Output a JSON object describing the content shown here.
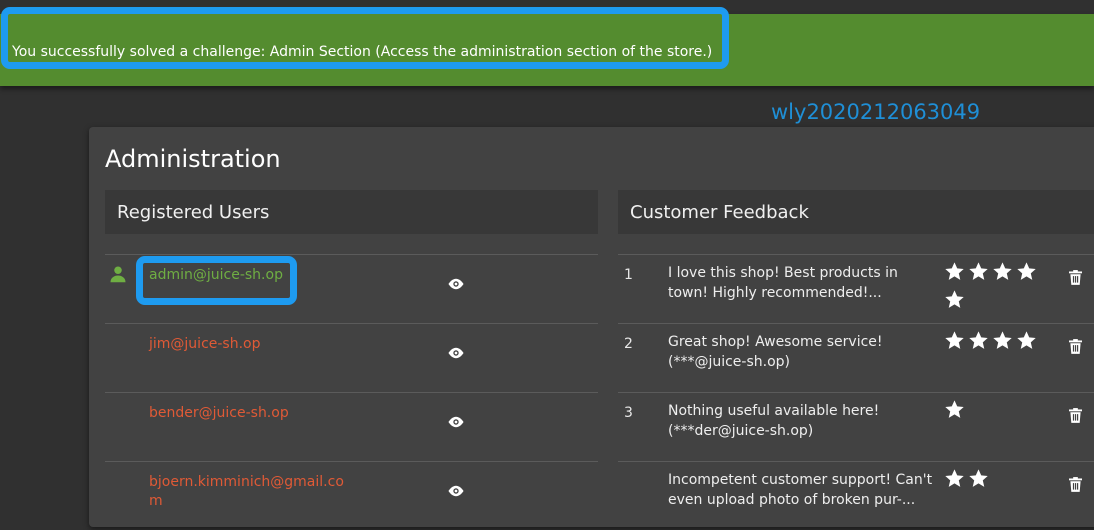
{
  "banner": {
    "message": "You successfully solved a challenge: Admin Section (Access the administration section of the store.)"
  },
  "watermark": "wly2020212063049",
  "admin": {
    "title": "Administration",
    "users_panel": {
      "title": "Registered Users",
      "users": [
        {
          "email": "admin@juice-sh.op",
          "icon": "person-icon",
          "action_icon": "eye-icon"
        },
        {
          "email": "jim@juice-sh.op",
          "action_icon": "eye-icon"
        },
        {
          "email": "bender@juice-sh.op",
          "action_icon": "eye-icon"
        },
        {
          "email": "bjoern.kimminich@gmail.com",
          "action_icon": "eye-icon"
        }
      ]
    },
    "feedback_panel": {
      "title": "Customer Feedback",
      "items": [
        {
          "id": "1",
          "comment": "I love this shop! Best products in town! Highly recommended!...",
          "rating": 5
        },
        {
          "id": "2",
          "comment": "Great shop! Awesome service! (***@juice-sh.op)",
          "rating": 4
        },
        {
          "id": "3",
          "comment": "Nothing useful available here! (***der@juice-sh.op)",
          "rating": 1
        },
        {
          "id": "",
          "comment": "Incompetent customer support! Can't even upload photo of broken pur-...",
          "rating": 2
        }
      ]
    }
  },
  "colors": {
    "banner_bg": "#548c2f",
    "highlight": "#1e9bf0",
    "admin_email": "#6fae43",
    "user_email": "#e05a36",
    "watermark": "#1f8fd6"
  }
}
